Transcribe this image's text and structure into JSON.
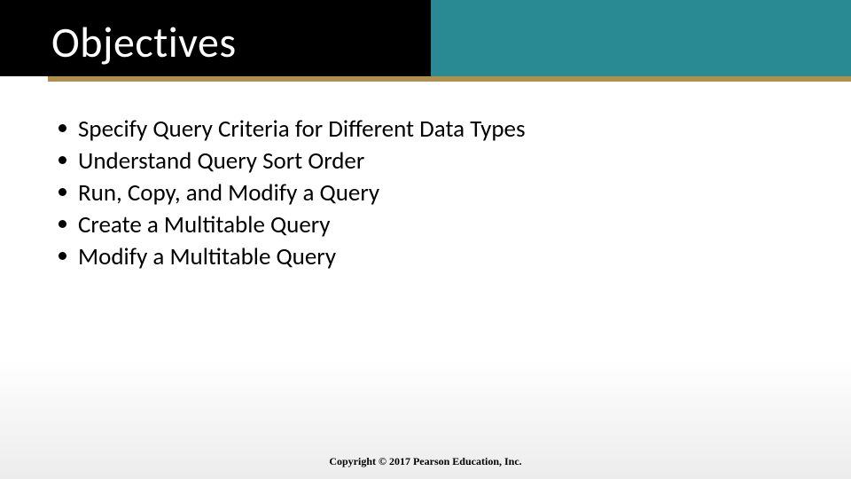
{
  "slide": {
    "title": "Objectives",
    "bullets": [
      "Specify Query Criteria for Different Data Types",
      "Understand Query Sort Order",
      "Run, Copy, and Modify a Query",
      "Create a Multitable Query",
      "Modify a Multitable Query"
    ],
    "copyright": "Copyright © 2017 Pearson Education, Inc."
  }
}
